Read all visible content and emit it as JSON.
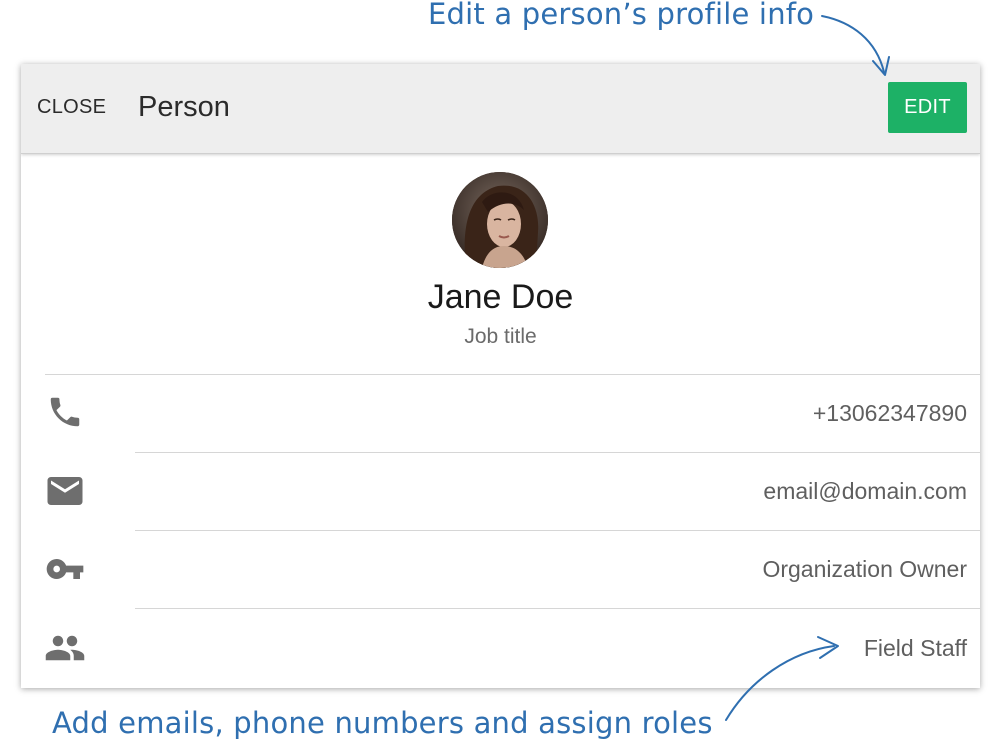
{
  "annotations": {
    "top": "Edit a person’s profile info",
    "bottom": "Add emails, phone numbers and assign roles"
  },
  "header": {
    "close_label": "CLOSE",
    "title": "Person",
    "edit_label": "EDIT"
  },
  "profile": {
    "name": "Jane Doe",
    "job_title": "Job title"
  },
  "details": {
    "phone": "+13062347890",
    "email": "email@domain.com",
    "role_permission": "Organization Owner",
    "group": "Field Staff"
  },
  "icons": {
    "phone": "phone-icon",
    "email": "email-icon",
    "key": "key-icon",
    "people": "people-icon"
  },
  "colors": {
    "accent_green": "#1db166",
    "annotation_blue": "#2f6fb0",
    "header_bg": "#eeeeee",
    "icon_grey": "#6e6e6e"
  }
}
